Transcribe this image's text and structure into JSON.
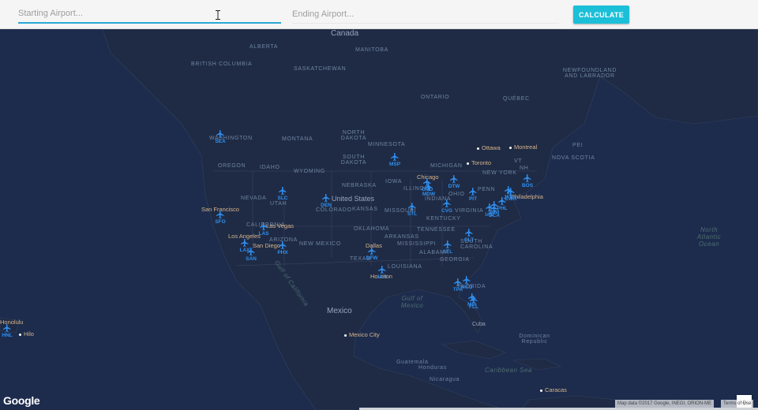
{
  "search": {
    "start_placeholder": "Starting Airport...",
    "end_placeholder": "Ending Airport...",
    "calculate_label": "CALCULATE"
  },
  "map": {
    "countries": [
      "Canada",
      "Mexico",
      "Cuba"
    ],
    "regions": [
      "BRITISH COLUMBIA",
      "ALBERTA",
      "MANITOBA",
      "SASKATCHEWAN",
      "ONTARIO",
      "QUÉBEC",
      "NEWFOUNDLAND AND LABRADOR",
      "WASHINGTON",
      "MONTANA",
      "NORTH DAKOTA",
      "MINNESOTA",
      "OREGON",
      "IDAHO",
      "WYOMING",
      "SOUTH DAKOTA",
      "MICHIGAN",
      "NEW YORK",
      "NH",
      "VT",
      "PEI",
      "NOVA SCOTIA",
      "NEVADA",
      "UTAH",
      "COLORADO",
      "NEBRASKA",
      "IOWA",
      "ILLINOIS",
      "INDIANA",
      "OHIO",
      "PENN",
      "KANSAS",
      "MISSOURI",
      "KENTUCKY",
      "VIRGINIA",
      "CALIFORNIA",
      "ARIZONA",
      "NEW MEXICO",
      "OKLAHOMA",
      "ARKANSAS",
      "TENNESSEE",
      "MISSISSIPPI",
      "ALABAMA",
      "GEORGIA",
      "SOUTH CAROLINA",
      "TEXAS",
      "LOUISIANA",
      "FLORIDA",
      "Dominican Republic",
      "Guatemala",
      "Honduras",
      "Nicaragua"
    ],
    "cities": [
      "Ottawa",
      "Montreal",
      "Toronto",
      "Chicago",
      "United States",
      "Philadelphia",
      "San Francisco",
      "Las Vegas",
      "Los Angeles",
      "San Diego",
      "Dallas",
      "Houston",
      "Mexico City",
      "Caracas",
      "Hilo",
      "Honolulu"
    ],
    "water": [
      "Gulf of Mexico",
      "Gulf of California",
      "North Atlantic Ocean",
      "Caribbean Sea"
    ],
    "airports": [
      "SEA",
      "SLC",
      "DEN",
      "SFO",
      "LAS",
      "LAX",
      "SAN",
      "PHX",
      "MSP",
      "ORD",
      "MDW",
      "DTW",
      "PIT",
      "STL",
      "CVG",
      "BOS",
      "PHL",
      "EWR",
      "JFK",
      "BWI",
      "IAD",
      "DCA",
      "CLT",
      "ATL",
      "DFW",
      "IAH",
      "TPA",
      "MCO",
      "FLL",
      "MIA",
      "HNL"
    ],
    "airport_color": "#2f8ff0",
    "water_color": "#1d2c4d",
    "land_color": "#1f2b45"
  },
  "controls": {
    "zoom_in": "+",
    "zoom_out": "−"
  },
  "footer": {
    "logo": "Google",
    "map_data": "Map data ©2017 Google, INEGI, ORION-ME",
    "terms": "Terms of Use"
  }
}
